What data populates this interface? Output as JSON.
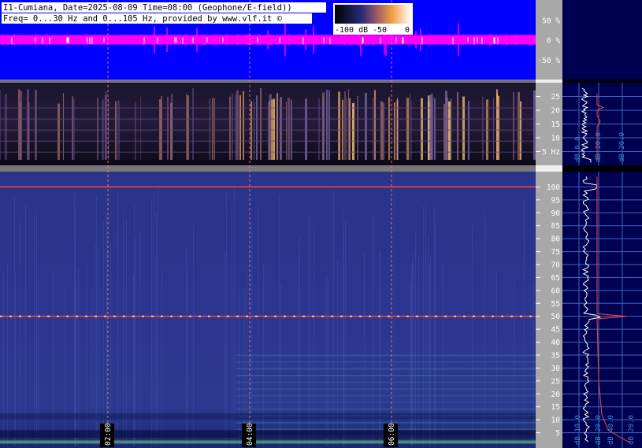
{
  "header": {
    "line1": "I1-Cumiana, Date=2025-08-09 Time=08:00 (Geophone/E-field))",
    "line2": "Freq= 0...30 Hz and 0...105 Hz, provided by www.vlf.it ©"
  },
  "colorbar": {
    "label_min": "-100 dB",
    "label_mid": "-50",
    "label_max": "0"
  },
  "chart_data": [
    {
      "type": "line",
      "name": "waveform-panel",
      "ylabel": "%",
      "ylim": [
        -100,
        100
      ],
      "y_ticks": [
        50,
        0,
        -50
      ],
      "y_tick_labels": [
        "50 %",
        "0 %",
        "-50 %"
      ],
      "trace_color": "#ff00ff",
      "background": "#0000ff"
    },
    {
      "type": "heatmap",
      "name": "spectrogram-low",
      "freq_range_hz": [
        0,
        30
      ],
      "y_ticks": [
        25,
        20,
        15,
        10,
        5
      ],
      "y_tick_labels": [
        "25",
        "20",
        "15",
        "10",
        "5 Hz"
      ],
      "spectrum_axis_labels": [
        "dB 0.0",
        "dB 10.0",
        "dB 20.0"
      ]
    },
    {
      "type": "heatmap",
      "name": "spectrogram-high",
      "freq_range_hz": [
        0,
        105
      ],
      "y_ticks": [
        100,
        95,
        90,
        85,
        80,
        75,
        70,
        65,
        60,
        55,
        50,
        45,
        40,
        35,
        30,
        25,
        20,
        15,
        10,
        5
      ],
      "y_tick_labels": [
        "100",
        "95",
        "90",
        "85",
        "80",
        "75",
        "70",
        "65",
        "60",
        "55",
        "50",
        "45",
        "40",
        "35",
        "30",
        "25",
        "20",
        "15",
        "10",
        "5"
      ],
      "marked_lines_hz": [
        100,
        50
      ],
      "spectrum_axis_labels": [
        "dB 10.0",
        "dB 20.0",
        "dB 40.0",
        "dB 20.0"
      ]
    }
  ],
  "time_axis": {
    "ticks": [
      "02:00",
      "04:00",
      "06:00"
    ]
  }
}
